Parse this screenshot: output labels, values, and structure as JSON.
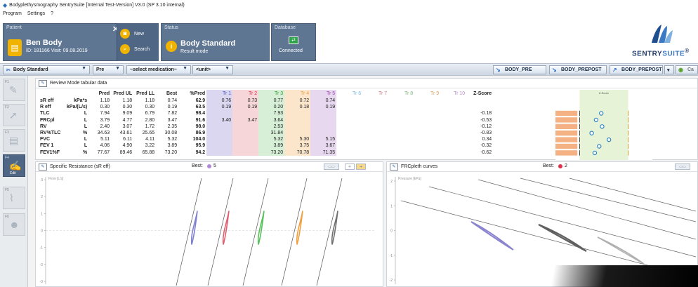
{
  "window": {
    "title": "Bodyplethysmography SentrySuite [Internal Test-Version] V3.0 (SP 3.10 internal)"
  },
  "menu": [
    "Program",
    "Settings",
    "?"
  ],
  "patient": {
    "label": "Patient",
    "name": "Ben Body",
    "id_line": "ID: 181166 Visit: 09.08.2019",
    "new_label": "New",
    "search_label": "Search"
  },
  "status": {
    "label": "Status",
    "mode": "Body Standard",
    "sub": "Result mode"
  },
  "database": {
    "label": "Database",
    "state": "Connected"
  },
  "logo": {
    "word_a": "SENTRY",
    "word_b": "SUITE",
    "mark": "®"
  },
  "toolbar": {
    "program": "Body Standard",
    "phase": "Pre",
    "medication": "~select medication~",
    "unit": "<unit>",
    "btn1": "BODY_PRE",
    "btn2": "BODY_PREPOST",
    "btn3": "BODY_PREPOST",
    "btn4": "Ca"
  },
  "rail": {
    "labels": [
      "F1",
      "F2",
      "F3",
      "F4",
      "F5",
      "F6"
    ],
    "active_label": "Edit"
  },
  "review": {
    "title": "Review Mode tabular data",
    "headers": [
      "Pred",
      "Pred UL",
      "Pred LL",
      "Best",
      "%Pred",
      "Tr 1",
      "Tr 2",
      "Tr 3",
      "Tr 4",
      "Tr 5",
      "Tr 6",
      "Tr 7",
      "Tr 8",
      "Tr 9",
      "Tr 10",
      "Z-Score"
    ],
    "rows": [
      {
        "param": "sR eff",
        "unit": "kPa*s",
        "pred": "1.18",
        "ul": "1.18",
        "ll": "1.18",
        "best": "0.74",
        "pct": "62.9",
        "t": [
          "0.76",
          "0.73",
          "0.77",
          "0.72",
          "0.74"
        ],
        "z": ""
      },
      {
        "param": "R eff",
        "unit": "kPa/(L/s)",
        "pred": "0.30",
        "ul": "0.30",
        "ll": "0.30",
        "best": "0.19",
        "pct": "63.5",
        "t": [
          "0.19",
          "0.19",
          "0.20",
          "0.18",
          "0.19"
        ],
        "z": ""
      },
      {
        "param": "TLC",
        "unit": "L",
        "pred": "7.94",
        "ul": "9.09",
        "ll": "6.79",
        "best": "7.82",
        "pct": "98.4",
        "t": [
          "",
          "",
          "7.93",
          "",
          ""
        ],
        "z": "-0.18"
      },
      {
        "param": "FRCpl",
        "unit": "L",
        "pred": "3.79",
        "ul": "4.77",
        "ll": "2.80",
        "best": "3.47",
        "pct": "91.6",
        "t": [
          "3.40",
          "3.47",
          "3.64",
          "",
          ""
        ],
        "z": "-0.53"
      },
      {
        "param": "RV",
        "unit": "L",
        "pred": "2.40",
        "ul": "3.07",
        "ll": "1.72",
        "best": "2.35",
        "pct": "98.0",
        "t": [
          "",
          "",
          "2.53",
          "",
          ""
        ],
        "z": "-0.12"
      },
      {
        "param": "RV%TLC",
        "unit": "%",
        "pred": "34.63",
        "ul": "43.61",
        "ll": "25.65",
        "best": "30.08",
        "pct": "86.9",
        "t": [
          "",
          "",
          "31.84",
          "",
          ""
        ],
        "z": "-0.83"
      },
      {
        "param": "FVC",
        "unit": "L",
        "pred": "5.11",
        "ul": "6.11",
        "ll": "4.11",
        "best": "5.32",
        "pct": "104.0",
        "t": [
          "",
          "",
          "5.32",
          "5.30",
          "5.15"
        ],
        "z": "0.34"
      },
      {
        "param": "FEV 1",
        "unit": "L",
        "pred": "4.06",
        "ul": "4.90",
        "ll": "3.22",
        "best": "3.89",
        "pct": "95.9",
        "t": [
          "",
          "",
          "3.89",
          "3.75",
          "3.67"
        ],
        "z": "-0.32"
      },
      {
        "param": "FEV1%F",
        "unit": "%",
        "pred": "77.67",
        "ul": "89.46",
        "ll": "65.88",
        "best": "73.20",
        "pct": "94.2",
        "t": [
          "",
          "",
          "73.20",
          "70.78",
          "71.35"
        ],
        "z": "-0.62"
      }
    ],
    "zscore_header": "Z-Score",
    "zscore_values": [
      null,
      null,
      -0.18,
      -0.53,
      -0.12,
      -0.83,
      0.34,
      -0.32,
      -0.62
    ]
  },
  "trial_colors": {
    "tr1": "#dcd7f0",
    "tr2": "#f6d6d8",
    "tr3": "#d6efd6",
    "tr4": "#fbe6cc",
    "tr5": "#e8d8ef"
  },
  "trial_header_colors": {
    "tr1": "#4a54c8",
    "tr2": "#e0304a",
    "tr3": "#2ca02c",
    "tr4": "#f0a040",
    "tr5": "#9a3fb0",
    "tr6": "#6fbce6",
    "tr7": "#d07a8a",
    "tr8": "#7ab87a",
    "tr9": "#e0a060",
    "tr10": "#b58ac9"
  },
  "sr_panel": {
    "title": "Specific Resistance (sR eff)",
    "best_label": "Best:",
    "best_trial": "5",
    "best_color": "#b38ad6",
    "axis_y": "Flow [L/s]",
    "ticks": [
      "3",
      "2",
      "1",
      "0",
      "-1",
      "-2",
      "-3"
    ]
  },
  "frc_panel": {
    "title": "FRCpleth curves",
    "best_label": "Best:",
    "best_trial": "2",
    "best_color": "#e0304a",
    "axis_y": "Pressure [kPa]",
    "ticks": [
      "2",
      "1",
      "0",
      "-1",
      "-2"
    ]
  }
}
